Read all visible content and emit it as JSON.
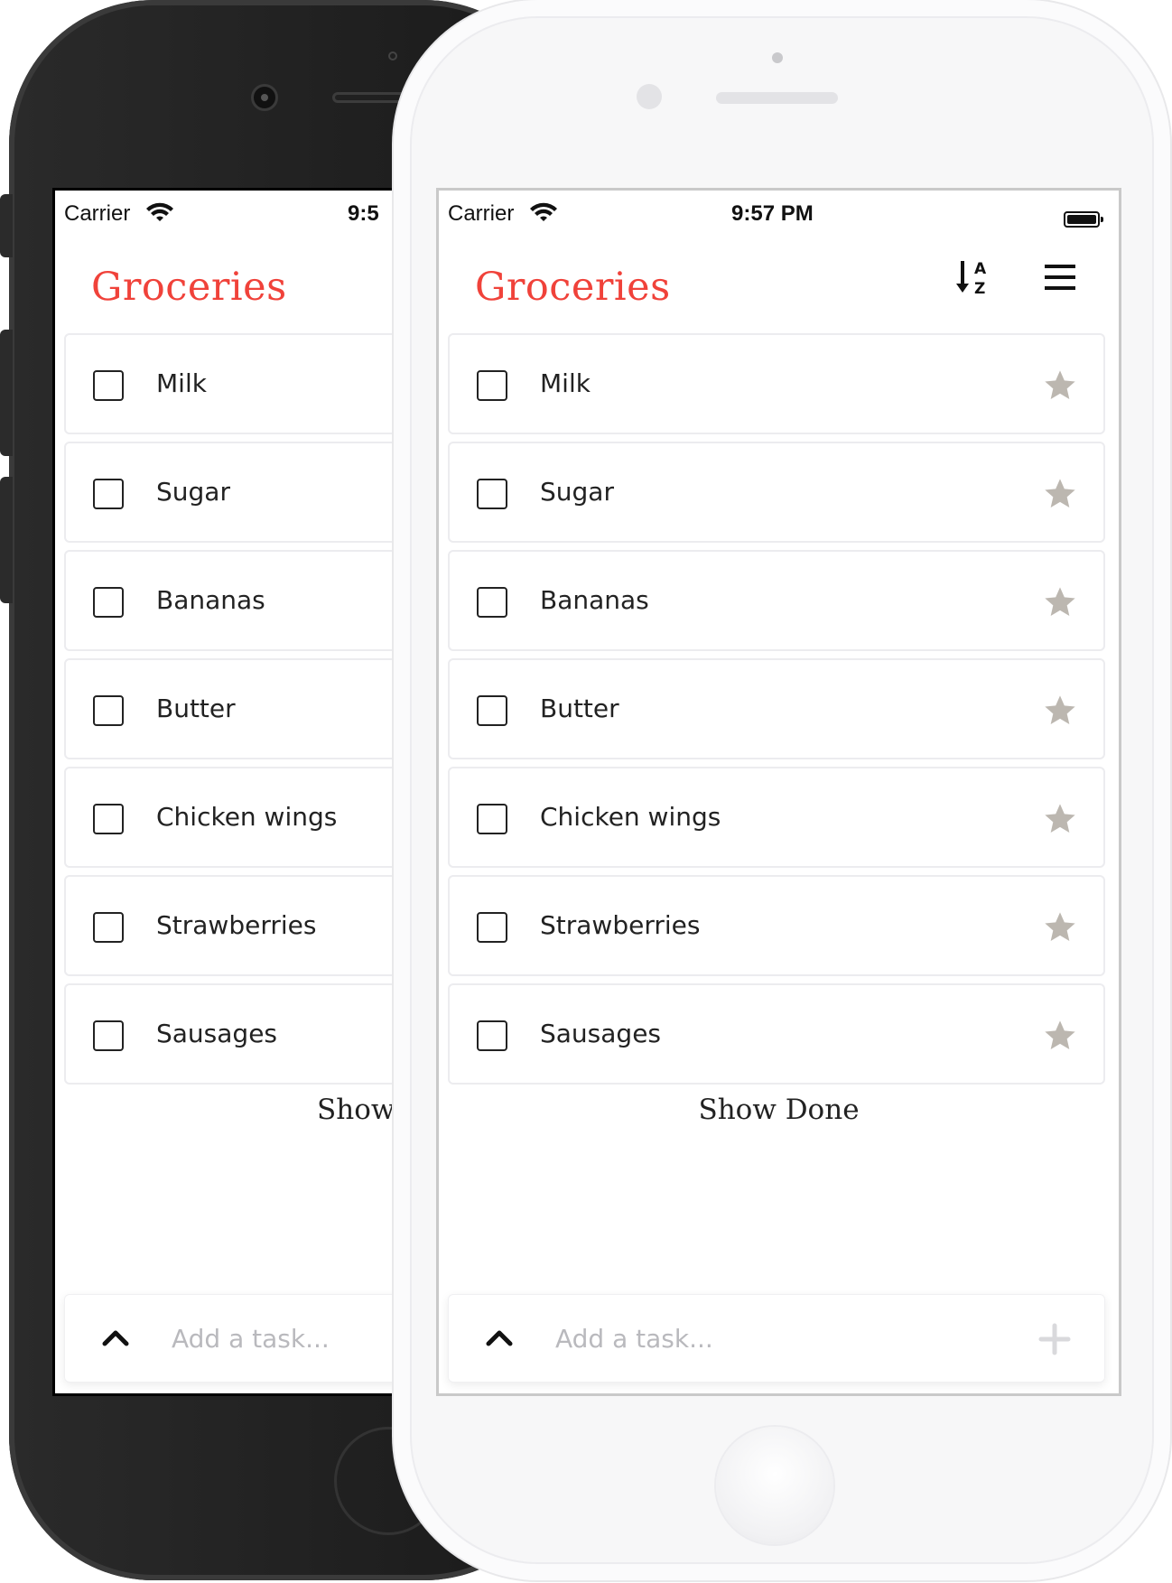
{
  "status_bar": {
    "carrier": "Carrier",
    "time": "9:57 PM",
    "time_truncated": "9:5"
  },
  "header": {
    "title": "Groceries",
    "sort_icon": "sort-alpha-icon",
    "menu_icon": "hamburger-menu-icon"
  },
  "tasks": [
    {
      "label": "Milk"
    },
    {
      "label": "Sugar"
    },
    {
      "label": "Bananas"
    },
    {
      "label": "Butter"
    },
    {
      "label": "Chicken wings"
    },
    {
      "label": "Strawberries"
    },
    {
      "label": "Sausages"
    }
  ],
  "show_done": {
    "label": "Show Done",
    "label_truncated": "Show"
  },
  "add_task": {
    "placeholder": "Add a task...",
    "expand_icon": "chevron-up-icon",
    "add_icon": "plus-icon"
  },
  "colors": {
    "accent": "#f0423a",
    "star": "#bcb7b0",
    "text": "#222222"
  }
}
